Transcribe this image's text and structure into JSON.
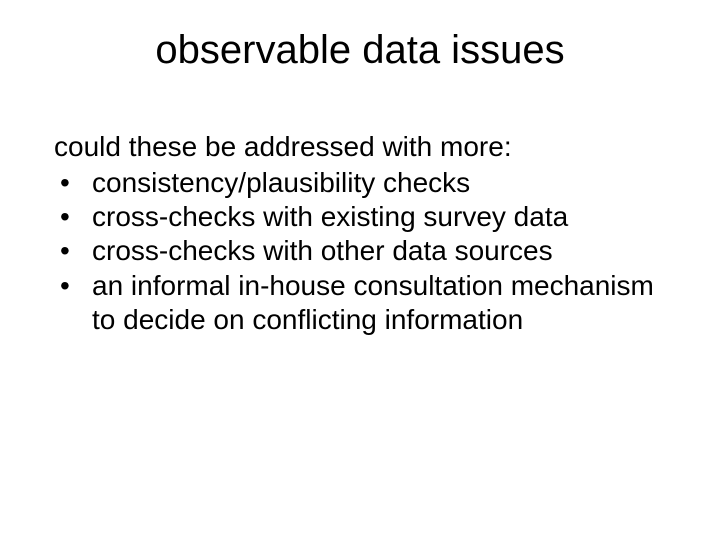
{
  "slide": {
    "title": "observable data issues",
    "lead": "could these be addressed with more:",
    "bullets": [
      "consistency/plausibility checks",
      "cross-checks with existing survey data",
      "cross-checks with other data sources",
      "an informal in-house consultation mechanism to decide on conflicting information"
    ]
  }
}
